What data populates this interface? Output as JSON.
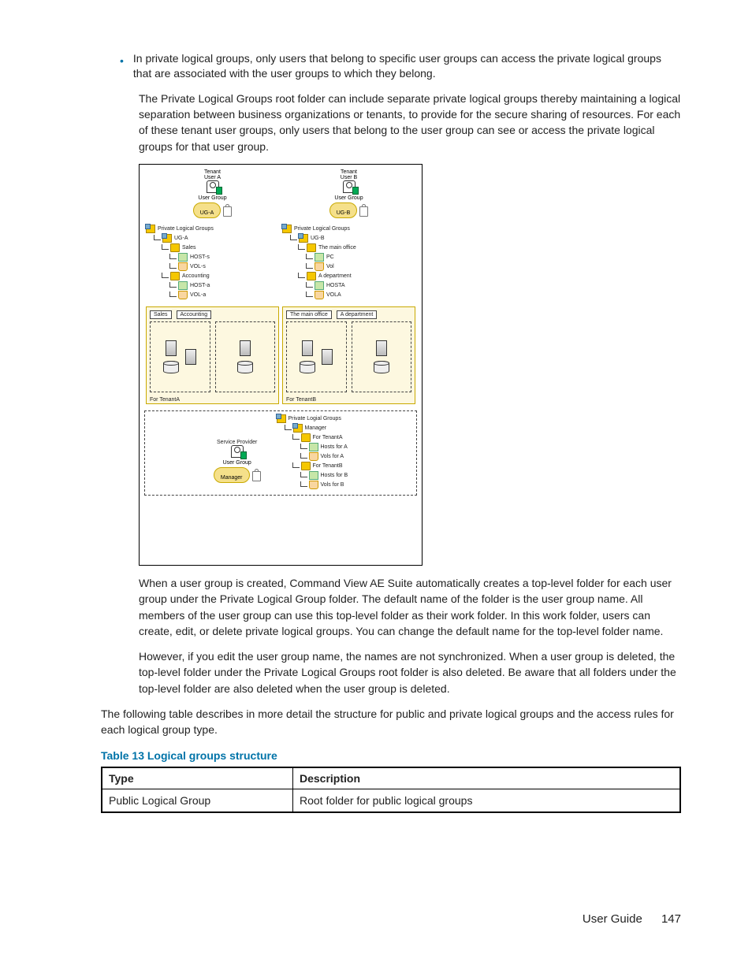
{
  "bullet": {
    "text": "In private logical groups, only users that belong to specific user groups can access the private logical groups that are associated with the user groups to which they belong."
  },
  "para1": "The Private Logical Groups root folder can include separate private logical groups thereby maintaining a logical separation between business organizations or tenants, to provide for the secure sharing of resources. For each of these tenant user groups, only users that belong to the user group can see or access the private logical groups for that user group.",
  "para2": "When a user group is created, Command View AE Suite automatically creates a top-level folder for each user group under the Private Logical Group folder. The default name of the folder is the user group name. All members of the user group can use this top-level folder as their work folder. In this work folder, users can create, edit, or delete private logical groups. You can change the default name for the top-level folder name.",
  "para3": "However, if you edit the user group name, the names are not synchronized. When a user group is deleted, the top-level folder under the Private Logical Groups root folder is also deleted. Be aware that all folders under the top-level folder are also deleted when the user group is deleted.",
  "para4": "The following table describes in more detail the structure for public and private logical groups and the access rules for each logical group type.",
  "table_caption": "Table 13 Logical groups structure",
  "table": {
    "header": {
      "col1": "Type",
      "col2": "Description"
    },
    "row1": {
      "col1": "Public Logical Group",
      "col2": "Root folder for public logical groups"
    }
  },
  "footer": {
    "label": "User Guide",
    "page": "147"
  },
  "diagram": {
    "tenantA": {
      "title": "Tenant",
      "user": "User A",
      "group_label": "User Group",
      "group_name": "UG-A",
      "root": "Private Logical Groups",
      "folder": "UG-A",
      "sub1": "Sales",
      "host1": "HOST-s",
      "vol1": "VOL-s",
      "sub2": "Accounting",
      "host2": "HOST-a",
      "vol2": "VOL-a",
      "box1": "Sales",
      "box2": "Accounting",
      "for": "For TenantA"
    },
    "tenantB": {
      "title": "Tenant",
      "user": "User B",
      "group_label": "User Group",
      "group_name": "UG-B",
      "root": "Private Logical Groups",
      "folder": "UG-B",
      "sub1": "The main office",
      "host1": "PC",
      "vol1": "Vol",
      "sub2": "A department",
      "host2": "HOSTA",
      "vol2": "VOLA",
      "box1": "The main office",
      "box2": "A department",
      "for": "For TenantB"
    },
    "manager": {
      "root": "Private Logial Groups",
      "mgr": "Manager",
      "t1": "For TenantA",
      "h1": "Hosts for A",
      "v1": "Vols for A",
      "t2": "For TenantB",
      "h2": "Hosts for B",
      "v2": "Vols for B",
      "sp": "Service Provider",
      "ug": "User Group",
      "ugname": "Manager"
    }
  }
}
